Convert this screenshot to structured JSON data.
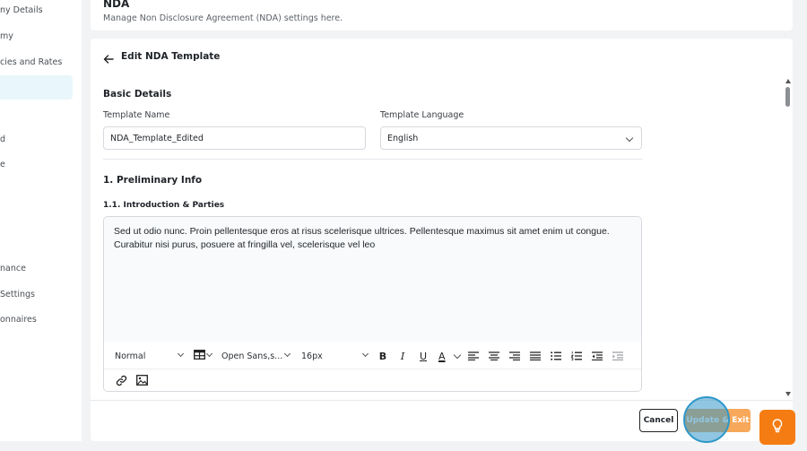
{
  "sidebar": {
    "items": [
      {
        "label": "ny Details"
      },
      {
        "label": "my"
      },
      {
        "label": "cies and Rates"
      },
      {
        "label": ""
      },
      {
        "label": "d"
      },
      {
        "label": "e"
      },
      {
        "label": "nance"
      },
      {
        "label": " Settings"
      },
      {
        "label": "onnaires"
      }
    ]
  },
  "header": {
    "title": "NDA",
    "subtitle": "Manage Non Disclosure Agreement (NDA) settings here."
  },
  "main": {
    "edit_title": "Edit NDA Template",
    "section_title": "Basic Details",
    "template_name_label": "Template Name",
    "template_name_value": "NDA_Template_Edited",
    "template_language_label": "Template Language",
    "template_language_value": "English",
    "section1_title": "1. Preliminary Info",
    "section11_title": "1.1. Introduction & Parties",
    "editor_text_line1": "Sed ut odio nunc. Proin pellentesque eros at risus scelerisque ultrices. Pellentesque maximus sit amet enim ut congue.",
    "editor_text_line2": "Curabitur nisi purus, posuere at fringilla vel, scelerisque vel leo"
  },
  "toolbar": {
    "format_value": "Normal",
    "font_value": "Open Sans,s...",
    "size_value": "16px",
    "bold": "B",
    "italic": "I",
    "underline": "U",
    "text_color": "A"
  },
  "footer": {
    "cancel_label": "Cancel",
    "update_label": "Update & Exit"
  },
  "colors": {
    "accent": "#f57c12",
    "active_bg": "#e9f6fb"
  }
}
